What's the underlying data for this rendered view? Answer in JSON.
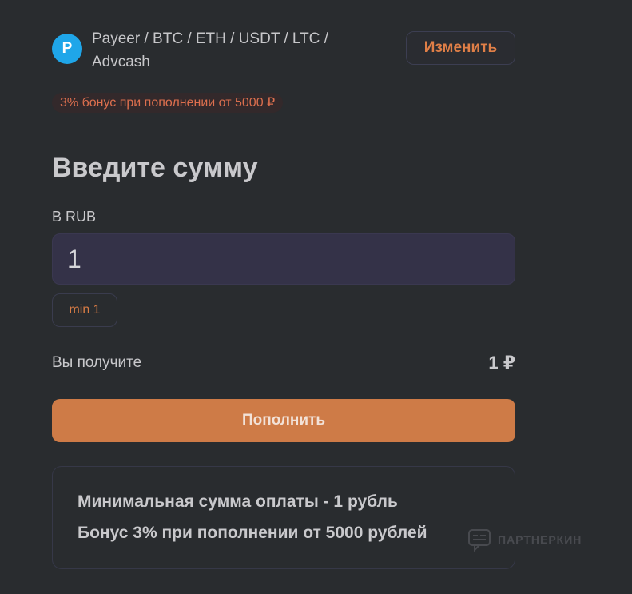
{
  "payment_method": {
    "logo_letter": "P",
    "name": "Payeer / BTC / ETH / USDT / LTC / Advcash",
    "change_label": "Изменить"
  },
  "bonus_badge": "3% бонус при пополнении от 5000 ₽",
  "title": "Введите сумму",
  "amount": {
    "label": "В RUB",
    "value": "1",
    "min_chip": "min 1"
  },
  "receive": {
    "label": "Вы получите",
    "value": "1 ₽"
  },
  "submit_label": "Пополнить",
  "info": {
    "line1": "Минимальная сумма оплаты - 1 рубль",
    "line2": "Бонус 3% при пополнении от 5000 рублей"
  },
  "watermark": "ПАРТНЕРКИН",
  "colors": {
    "background": "#292c2f",
    "accent": "#ce7b47",
    "payeer_blue": "#1fa6e9",
    "input_bg": "#343248"
  }
}
